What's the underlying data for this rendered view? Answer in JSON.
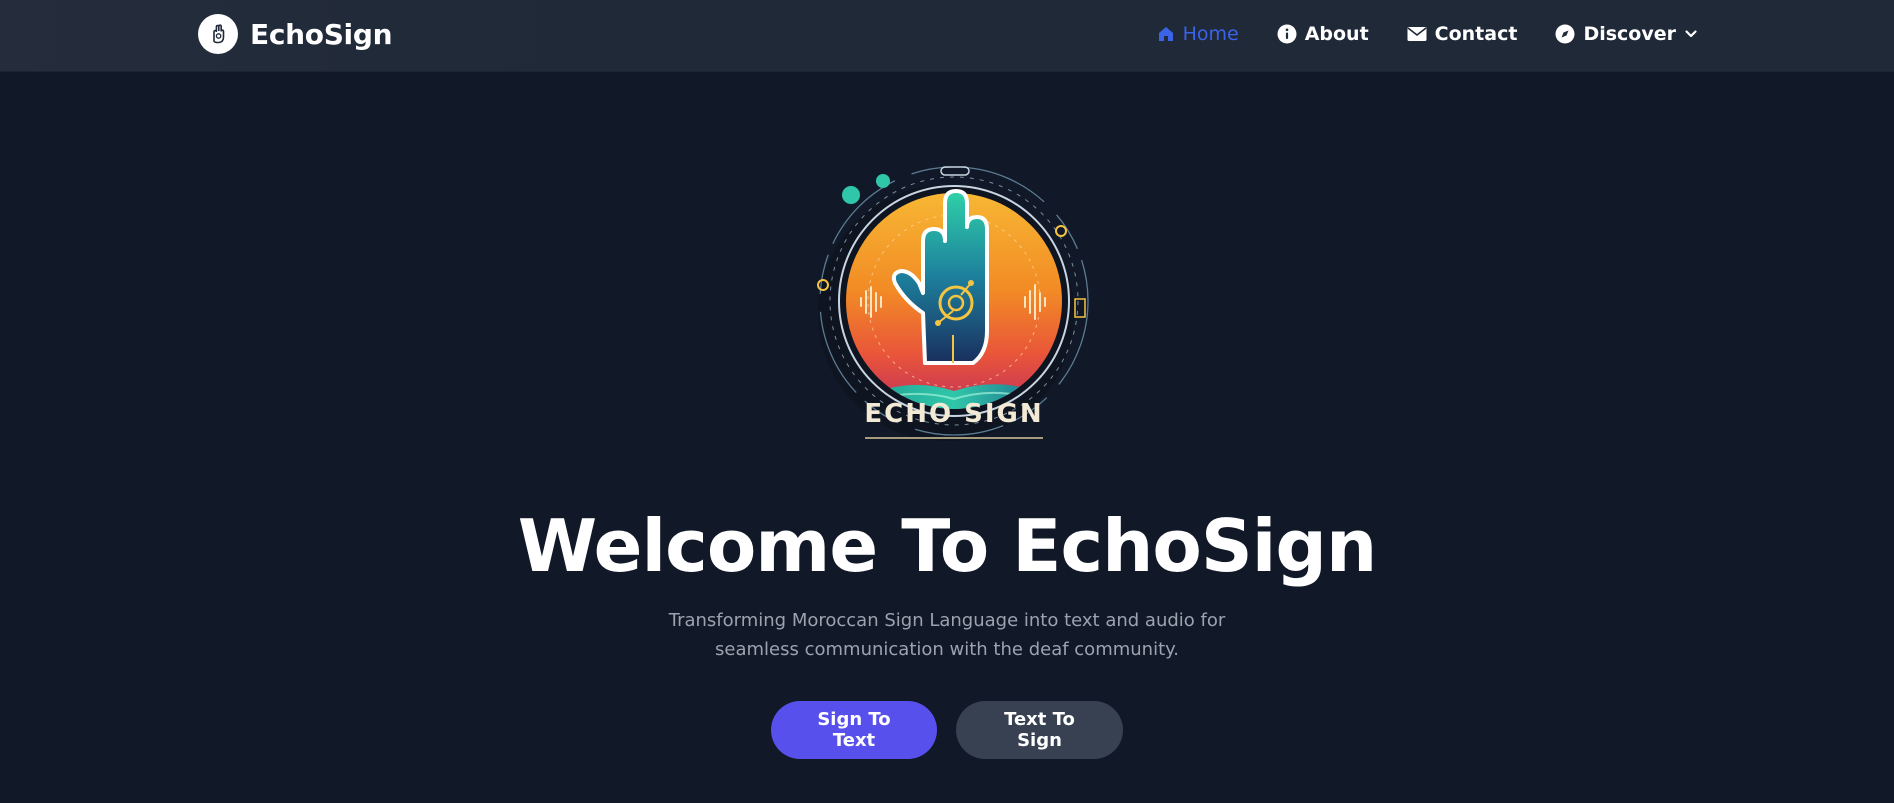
{
  "brand": {
    "name": "EchoSign",
    "logo_icon": "hand-icon"
  },
  "nav": {
    "items": [
      {
        "label": "Home",
        "icon": "house-icon",
        "active": true
      },
      {
        "label": "About",
        "icon": "info-icon",
        "active": false
      },
      {
        "label": "Contact",
        "icon": "envelope-icon",
        "active": false
      },
      {
        "label": "Discover",
        "icon": "compass-icon",
        "active": false,
        "dropdown": true
      }
    ]
  },
  "hero": {
    "logo_text": "ECHO SIGN",
    "title": "Welcome To EchoSign",
    "subtitle": "Transforming Moroccan Sign Language into text and audio for seamless communication with the deaf community.",
    "primary_button": "Sign To Text",
    "secondary_button": "Text To Sign"
  },
  "colors": {
    "background": "#111827",
    "navbar": "#1f2937",
    "active_link": "#3b63e8",
    "primary_button": "#5850ec",
    "secondary_button": "#374151",
    "subtitle_text": "#9ca3af"
  }
}
